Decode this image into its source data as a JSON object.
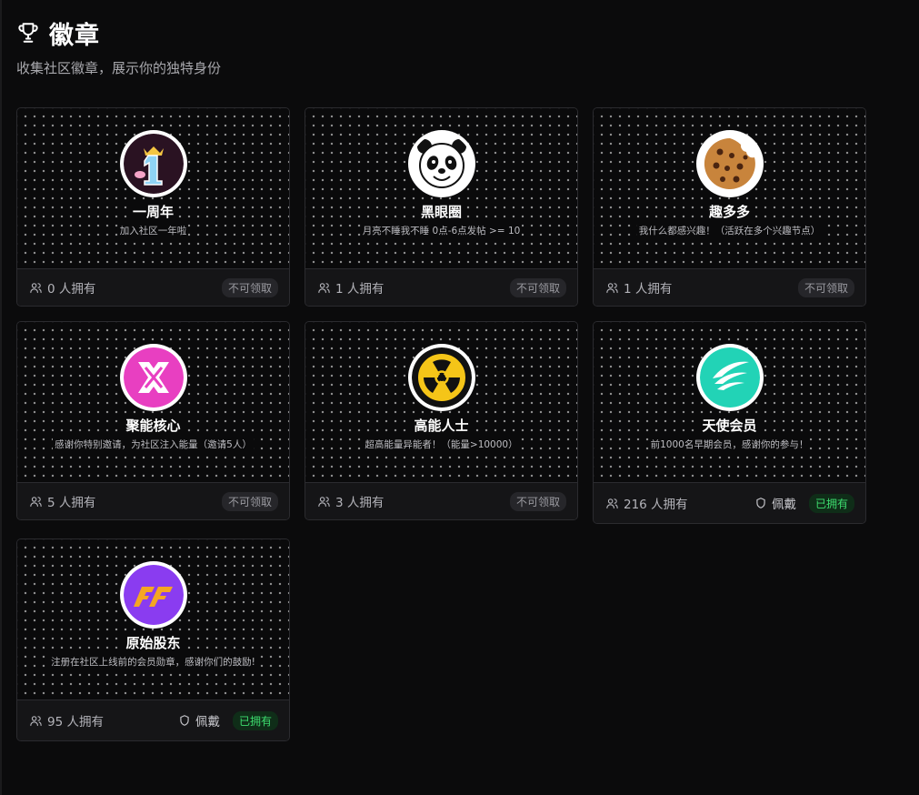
{
  "header": {
    "icon": "trophy-icon",
    "title": "徽章",
    "subtitle": "收集社区徽章，展示你的独特身份"
  },
  "colors": {
    "background": "#0b0b0c",
    "card": "#141416",
    "owned_green": "#3ddc6e"
  },
  "badges": [
    {
      "icon": "first-anniversary-icon",
      "name": "一周年",
      "desc": "加入社区一年啦",
      "owners": "0 人拥有",
      "status": "不可领取",
      "owned": false
    },
    {
      "icon": "panda-icon",
      "name": "黑眼圈",
      "desc": "月亮不睡我不睡 0点-6点发帖 >= 10",
      "owners": "1 人拥有",
      "status": "不可领取",
      "owned": false
    },
    {
      "icon": "cookie-icon",
      "name": "趣多多",
      "desc": "我什么都感兴趣！（活跃在多个兴趣节点）",
      "owners": "1 人拥有",
      "status": "不可领取",
      "owned": false
    },
    {
      "icon": "core-x-icon",
      "name": "聚能核心",
      "desc": "感谢你特别邀请，为社区注入能量（邀请5人）",
      "owners": "5 人拥有",
      "status": "不可领取",
      "owned": false
    },
    {
      "icon": "radiation-icon",
      "name": "高能人士",
      "desc": "超高能量异能者！（能量>10000）",
      "owners": "3 人拥有",
      "status": "不可领取",
      "owned": false
    },
    {
      "icon": "angel-wing-icon",
      "name": "天使会员",
      "desc": "前1000名早期会员，感谢你的参与！",
      "owners": "216 人拥有",
      "wear": "佩戴",
      "status": "已拥有",
      "owned": true
    },
    {
      "icon": "shareholder-icon",
      "name": "原始股东",
      "desc": "注册在社区上线前的会员勋章，感谢你们的鼓励!",
      "owners": "95 人拥有",
      "wear": "佩戴",
      "status": "已拥有",
      "owned": true
    }
  ]
}
